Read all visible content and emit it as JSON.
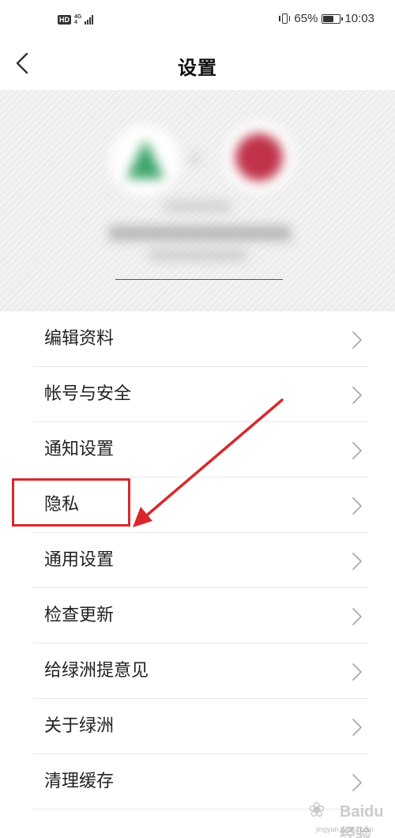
{
  "status_bar": {
    "hd": "HD",
    "network_top": "4G",
    "network_bottom": "4",
    "battery_percent": "65%",
    "battery_level": 0.65,
    "time": "10:03"
  },
  "nav": {
    "title": "设置",
    "back_icon": "chevron-left-icon"
  },
  "settings": {
    "items": [
      {
        "label": "编辑资料",
        "icon": "chevron-right-icon"
      },
      {
        "label": "帐号与安全",
        "icon": "chevron-right-icon"
      },
      {
        "label": "通知设置",
        "icon": "chevron-right-icon"
      },
      {
        "label": "隐私",
        "icon": "chevron-right-icon"
      },
      {
        "label": "通用设置",
        "icon": "chevron-right-icon"
      },
      {
        "label": "检查更新",
        "icon": "chevron-right-icon"
      },
      {
        "label": "给绿洲提意见",
        "icon": "chevron-right-icon"
      },
      {
        "label": "关于绿洲",
        "icon": "chevron-right-icon"
      },
      {
        "label": "清理缓存",
        "icon": "chevron-right-icon"
      }
    ]
  },
  "annotation": {
    "color": "#d8282d",
    "target": "隐私"
  },
  "watermark": {
    "text": "Baidu 经验",
    "sub": "jingyan.baidu.com"
  }
}
